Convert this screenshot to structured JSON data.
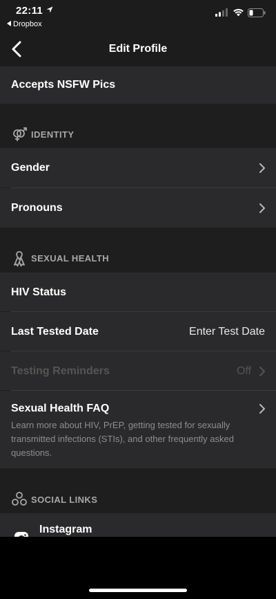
{
  "status_bar": {
    "time": "22:11",
    "back_app": "Dropbox"
  },
  "nav": {
    "title": "Edit Profile"
  },
  "rows": {
    "nsfw": {
      "label": "Accepts NSFW Pics"
    },
    "gender": {
      "label": "Gender"
    },
    "pronouns": {
      "label": "Pronouns"
    },
    "hiv_status": {
      "label": "HIV Status"
    },
    "last_tested": {
      "label": "Last Tested Date",
      "value": "Enter Test Date"
    },
    "testing_reminders": {
      "label": "Testing Reminders",
      "value": "Off"
    },
    "faq": {
      "label": "Sexual Health FAQ",
      "description": "Learn more about HIV, PrEP, getting tested for sexually transmitted infections (STIs), and other frequently asked questions."
    },
    "instagram": {
      "label": "Instagram"
    }
  },
  "sections": {
    "identity": "IDENTITY",
    "sexual_health": "SEXUAL HEALTH",
    "social_links": "SOCIAL LINKS"
  },
  "colors": {
    "background": "#1e1e1e",
    "row_background": "#2a2a2c",
    "section_title": "#a8a8a8",
    "disabled_text": "#555555",
    "description_text": "#8e8e8e"
  }
}
